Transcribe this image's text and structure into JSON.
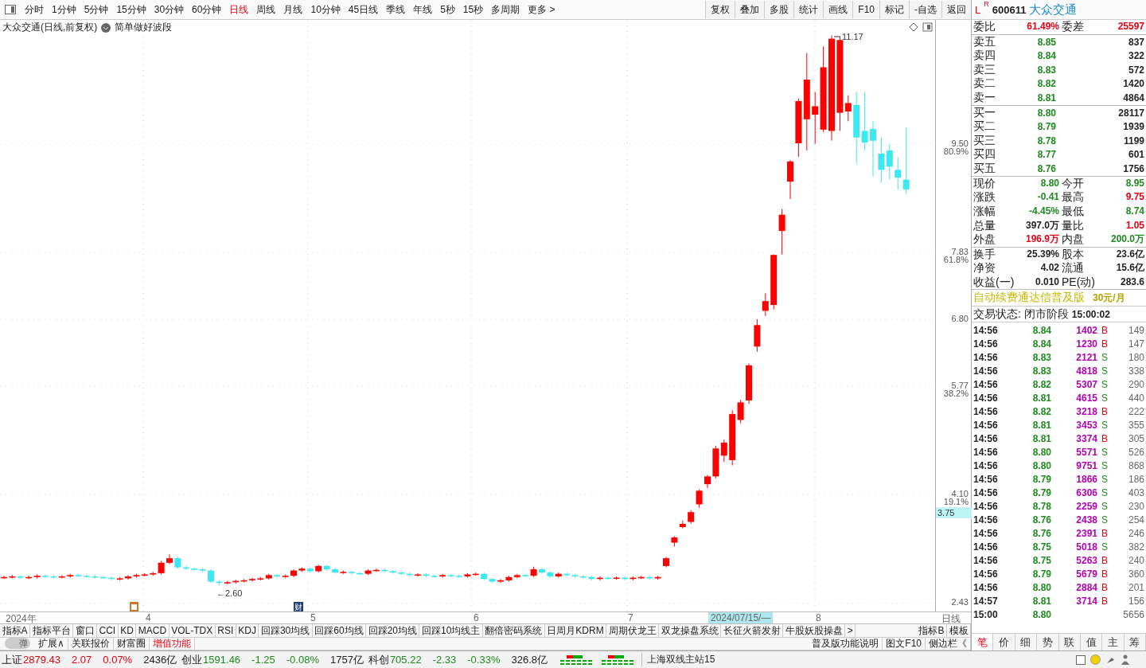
{
  "toolbar": {
    "periods": [
      {
        "label": "分时",
        "selected": false
      },
      {
        "label": "1分钟",
        "selected": false
      },
      {
        "label": "5分钟",
        "selected": false
      },
      {
        "label": "15分钟",
        "selected": false
      },
      {
        "label": "30分钟",
        "selected": false
      },
      {
        "label": "60分钟",
        "selected": false
      },
      {
        "label": "日线",
        "selected": true
      },
      {
        "label": "周线",
        "selected": false
      },
      {
        "label": "月线",
        "selected": false
      },
      {
        "label": "10分钟",
        "selected": false
      },
      {
        "label": "45日线",
        "selected": false
      },
      {
        "label": "季线",
        "selected": false
      },
      {
        "label": "年线",
        "selected": false
      },
      {
        "label": "5秒",
        "selected": false
      },
      {
        "label": "15秒",
        "selected": false
      },
      {
        "label": "多周期",
        "selected": false
      }
    ],
    "more": "更多 >",
    "actions": [
      "复权",
      "叠加",
      "多股",
      "统计",
      "画线",
      "F10",
      "标记",
      "-自选",
      "返回"
    ]
  },
  "chart": {
    "title": "大众交通(日线,前复权)",
    "indicator": "简单做好波段",
    "high_label": "11.17",
    "low_label": "←2.60",
    "marker": "财",
    "pct_labels": [
      "80.9%",
      "61.8%",
      "38.2%",
      "19.1%"
    ],
    "current_price": "3.75",
    "x_labels": [
      {
        "label": "2024年",
        "highlight": false
      },
      {
        "label": "4",
        "highlight": false
      },
      {
        "label": "5",
        "highlight": false
      },
      {
        "label": "6",
        "highlight": false
      },
      {
        "label": "7",
        "highlight": false
      },
      {
        "label": "2024/07/15/—",
        "highlight": true
      },
      {
        "label": "8",
        "highlight": false
      }
    ],
    "axis_title": "日线",
    "chart_data": {
      "type": "candlestick",
      "grid": true,
      "ylim": [
        2.3,
        11.41
      ],
      "yticks": [
        {
          "value": 9.5,
          "label": "9.50"
        },
        {
          "value": 7.83,
          "label": "7.83"
        },
        {
          "value": 6.8,
          "label": "6.80"
        },
        {
          "value": 5.77,
          "label": "5.77"
        },
        {
          "value": 4.1,
          "label": "4.10"
        },
        {
          "value": 2.43,
          "label": "2.43"
        }
      ],
      "ohlc": [
        [
          2.82,
          2.85,
          2.8,
          2.83
        ],
        [
          2.83,
          2.86,
          2.81,
          2.84
        ],
        [
          2.84,
          2.86,
          2.8,
          2.82
        ],
        [
          2.82,
          2.85,
          2.8,
          2.83
        ],
        [
          2.83,
          2.87,
          2.81,
          2.85
        ],
        [
          2.85,
          2.87,
          2.82,
          2.84
        ],
        [
          2.84,
          2.86,
          2.81,
          2.83
        ],
        [
          2.83,
          2.86,
          2.81,
          2.84
        ],
        [
          2.84,
          2.88,
          2.82,
          2.86
        ],
        [
          2.86,
          2.88,
          2.83,
          2.85
        ],
        [
          2.85,
          2.87,
          2.82,
          2.84
        ],
        [
          2.84,
          2.86,
          2.81,
          2.83
        ],
        [
          2.83,
          2.85,
          2.8,
          2.82
        ],
        [
          2.82,
          2.84,
          2.78,
          2.8
        ],
        [
          2.8,
          2.83,
          2.78,
          2.81
        ],
        [
          2.81,
          2.86,
          2.79,
          2.84
        ],
        [
          2.84,
          2.88,
          2.82,
          2.86
        ],
        [
          2.86,
          2.89,
          2.84,
          2.87
        ],
        [
          2.87,
          2.91,
          2.85,
          2.89
        ],
        [
          2.89,
          3.08,
          2.87,
          3.05
        ],
        [
          3.05,
          3.18,
          3.03,
          3.12
        ],
        [
          3.12,
          3.14,
          2.96,
          2.98
        ],
        [
          2.98,
          3.0,
          2.94,
          2.96
        ],
        [
          2.96,
          2.98,
          2.93,
          2.95
        ],
        [
          2.95,
          2.97,
          2.91,
          2.93
        ],
        [
          2.93,
          2.95,
          2.74,
          2.76
        ],
        [
          2.76,
          2.78,
          2.7,
          2.74
        ],
        [
          2.74,
          2.77,
          2.72,
          2.75
        ],
        [
          2.75,
          2.79,
          2.73,
          2.77
        ],
        [
          2.77,
          2.8,
          2.75,
          2.78
        ],
        [
          2.78,
          2.82,
          2.76,
          2.8
        ],
        [
          2.8,
          2.83,
          2.78,
          2.81
        ],
        [
          2.81,
          2.88,
          2.79,
          2.86
        ],
        [
          2.86,
          2.88,
          2.82,
          2.84
        ],
        [
          2.84,
          2.87,
          2.82,
          2.85
        ],
        [
          2.85,
          2.95,
          2.83,
          2.93
        ],
        [
          2.93,
          2.98,
          2.91,
          2.96
        ],
        [
          2.96,
          2.98,
          2.9,
          2.92
        ],
        [
          2.92,
          3.02,
          2.9,
          3.0
        ],
        [
          3.0,
          3.02,
          2.93,
          2.95
        ],
        [
          2.95,
          2.97,
          2.88,
          2.9
        ],
        [
          2.9,
          2.93,
          2.88,
          2.91
        ],
        [
          2.91,
          2.93,
          2.87,
          2.89
        ],
        [
          2.89,
          2.91,
          2.86,
          2.88
        ],
        [
          2.88,
          2.95,
          2.86,
          2.93
        ],
        [
          2.93,
          2.96,
          2.91,
          2.94
        ],
        [
          2.94,
          2.96,
          2.9,
          2.92
        ],
        [
          2.92,
          2.94,
          2.88,
          2.9
        ],
        [
          2.9,
          2.92,
          2.86,
          2.88
        ],
        [
          2.88,
          2.9,
          2.84,
          2.86
        ],
        [
          2.86,
          2.89,
          2.84,
          2.87
        ],
        [
          2.87,
          2.89,
          2.83,
          2.85
        ],
        [
          2.85,
          2.87,
          2.82,
          2.84
        ],
        [
          2.84,
          2.88,
          2.82,
          2.86
        ],
        [
          2.86,
          2.88,
          2.83,
          2.85
        ],
        [
          2.85,
          2.87,
          2.82,
          2.84
        ],
        [
          2.84,
          2.89,
          2.82,
          2.87
        ],
        [
          2.87,
          2.9,
          2.85,
          2.88
        ],
        [
          2.88,
          2.9,
          2.78,
          2.8
        ],
        [
          2.8,
          2.82,
          2.74,
          2.76
        ],
        [
          2.76,
          2.8,
          2.74,
          2.78
        ],
        [
          2.78,
          2.85,
          2.76,
          2.83
        ],
        [
          2.83,
          2.88,
          2.81,
          2.86
        ],
        [
          2.86,
          2.88,
          2.83,
          2.85
        ],
        [
          2.85,
          2.99,
          2.83,
          2.95
        ],
        [
          2.95,
          2.97,
          2.88,
          2.9
        ],
        [
          2.9,
          2.92,
          2.82,
          2.84
        ],
        [
          2.84,
          2.9,
          2.82,
          2.88
        ],
        [
          2.88,
          2.9,
          2.84,
          2.86
        ],
        [
          2.86,
          2.88,
          2.82,
          2.84
        ],
        [
          2.84,
          2.86,
          2.81,
          2.83
        ],
        [
          2.83,
          2.85,
          2.78,
          2.8
        ],
        [
          2.8,
          2.84,
          2.78,
          2.82
        ],
        [
          2.82,
          2.84,
          2.79,
          2.81
        ],
        [
          2.81,
          2.84,
          2.79,
          2.82
        ],
        [
          2.82,
          2.84,
          2.78,
          2.8
        ],
        [
          2.8,
          2.84,
          2.78,
          2.82
        ],
        [
          2.82,
          2.85,
          2.8,
          2.83
        ],
        [
          2.83,
          2.85,
          2.79,
          2.81
        ],
        [
          2.81,
          2.85,
          2.79,
          2.83
        ],
        [
          3.0,
          3.14,
          2.98,
          3.12
        ],
        [
          3.36,
          3.46,
          3.3,
          3.44
        ],
        [
          3.6,
          3.7,
          3.58,
          3.65
        ],
        [
          3.68,
          3.86,
          3.65,
          3.83
        ],
        [
          3.95,
          4.18,
          3.9,
          4.16
        ],
        [
          4.26,
          4.4,
          4.2,
          4.38
        ],
        [
          4.38,
          4.85,
          4.35,
          4.81
        ],
        [
          4.7,
          4.95,
          4.6,
          4.9
        ],
        [
          4.63,
          5.4,
          4.55,
          5.34
        ],
        [
          5.25,
          5.56,
          5.2,
          5.52
        ],
        [
          5.55,
          6.12,
          5.5,
          6.09
        ],
        [
          6.38,
          6.8,
          6.3,
          6.71
        ],
        [
          6.93,
          7.2,
          6.85,
          7.08
        ],
        [
          7.02,
          7.8,
          6.95,
          7.79
        ],
        [
          8.16,
          8.5,
          7.8,
          8.41
        ],
        [
          8.92,
          9.25,
          8.65,
          9.23
        ],
        [
          9.51,
          10.2,
          9.3,
          10.16
        ],
        [
          9.88,
          10.9,
          9.4,
          10.49
        ],
        [
          9.95,
          10.3,
          9.5,
          10.08
        ],
        [
          9.72,
          11.0,
          9.68,
          10.68
        ],
        [
          9.7,
          11.17,
          9.55,
          11.12
        ],
        [
          9.98,
          11.15,
          9.7,
          11.1
        ],
        [
          10.0,
          10.25,
          9.85,
          10.13
        ],
        [
          10.1,
          10.3,
          9.2,
          9.6
        ],
        [
          9.7,
          10.3,
          9.4,
          9.52
        ],
        [
          9.73,
          9.85,
          9.0,
          9.55
        ],
        [
          9.35,
          9.6,
          8.9,
          9.1
        ],
        [
          9.4,
          9.5,
          8.95,
          9.15
        ],
        [
          9.1,
          9.3,
          8.8,
          8.98
        ],
        [
          8.95,
          9.75,
          8.74,
          8.8
        ]
      ]
    }
  },
  "indicator_tabs": [
    "指标A",
    "指标平台",
    "窗口",
    "CCI",
    "KD",
    "MACD",
    "VOL-TDX",
    "RSI",
    "KDJ",
    "回踩30均线",
    "回踩60均线",
    "回踩20均线",
    "回踩10均线主",
    "翻倍密码系统",
    "日周月KDRM",
    "周期伏龙王",
    "双龙操盘系统",
    "长征火箭发射",
    "牛股妖股操盘",
    ">"
  ],
  "indicator_right": [
    "指标B",
    "模板"
  ],
  "function_bar": {
    "toggle": {
      "label": "弹",
      "on": false
    },
    "items": [
      {
        "label": "扩展∧",
        "kind": "plain"
      },
      {
        "label": "关联报价",
        "kind": "plain"
      },
      {
        "label": "财富圈",
        "kind": "plain"
      },
      {
        "label": "增值功能",
        "kind": "accent"
      }
    ],
    "right": [
      "普及版功能说明",
      "图文F10",
      "侧边栏《"
    ]
  },
  "quote": {
    "flags": [
      "L",
      "R"
    ],
    "code": "600611",
    "name": "大众交通",
    "ratio": {
      "label": "委比",
      "value": "61.49%",
      "label2": "委差",
      "value2": "25597"
    },
    "asks": [
      {
        "label": "卖五",
        "price": "8.85",
        "volume": "837"
      },
      {
        "label": "卖四",
        "price": "8.84",
        "volume": "322"
      },
      {
        "label": "卖三",
        "price": "8.83",
        "volume": "572"
      },
      {
        "label": "卖二",
        "price": "8.82",
        "volume": "1420"
      },
      {
        "label": "卖一",
        "price": "8.81",
        "volume": "4864"
      }
    ],
    "bids": [
      {
        "label": "买一",
        "price": "8.80",
        "volume": "28117"
      },
      {
        "label": "买二",
        "price": "8.79",
        "volume": "1939"
      },
      {
        "label": "买三",
        "price": "8.78",
        "volume": "1199"
      },
      {
        "label": "买四",
        "price": "8.77",
        "volume": "601"
      },
      {
        "label": "买五",
        "price": "8.76",
        "volume": "1756"
      }
    ],
    "stats": [
      {
        "left": {
          "label": "现价",
          "value": "8.80",
          "color": "#1f8a1f"
        },
        "right": {
          "label": "今开",
          "value": "8.95",
          "color": "#1f8a1f"
        }
      },
      {
        "left": {
          "label": "涨跌",
          "value": "-0.41",
          "color": "#1f8a1f"
        },
        "right": {
          "label": "最高",
          "value": "9.75",
          "color": "#e60012"
        }
      },
      {
        "left": {
          "label": "涨幅",
          "value": "-4.45%",
          "color": "#1f8a1f"
        },
        "right": {
          "label": "最低",
          "value": "8.74",
          "color": "#1f8a1f"
        }
      },
      {
        "left": {
          "label": "总量",
          "value": "397.0万",
          "color": "#222222"
        },
        "right": {
          "label": "量比",
          "value": "1.05",
          "color": "#e60012"
        }
      },
      {
        "left": {
          "label": "外盘",
          "value": "196.9万",
          "color": "#e60012"
        },
        "right": {
          "label": "内盘",
          "value": "200.0万",
          "color": "#1f8a1f"
        }
      }
    ],
    "fundamentals": [
      {
        "label": "换手",
        "value": "25.39%",
        "label2": "股本",
        "value2": "23.6亿"
      },
      {
        "label": "净资",
        "value": "4.02",
        "label2": "流通",
        "value2": "15.6亿"
      },
      {
        "label": "收益(一)",
        "value": "0.010",
        "label2": "PE(动)",
        "value2": "283.6"
      }
    ],
    "ad": {
      "text": "自动续费通达信普及版",
      "price": "30元/月"
    },
    "status": {
      "label": "交易状态: 闭市阶段",
      "time": "15:00:02"
    },
    "trades": [
      {
        "time": "14:56",
        "price": "8.84",
        "volume": "1402",
        "side": "B",
        "count": "149"
      },
      {
        "time": "14:56",
        "price": "8.84",
        "volume": "1230",
        "side": "B",
        "count": "147"
      },
      {
        "time": "14:56",
        "price": "8.83",
        "volume": "2121",
        "side": "S",
        "count": "180"
      },
      {
        "time": "14:56",
        "price": "8.83",
        "volume": "4818",
        "side": "S",
        "count": "338"
      },
      {
        "time": "14:56",
        "price": "8.82",
        "volume": "5307",
        "side": "S",
        "count": "290"
      },
      {
        "time": "14:56",
        "price": "8.81",
        "volume": "4615",
        "side": "S",
        "count": "440"
      },
      {
        "time": "14:56",
        "price": "8.82",
        "volume": "3218",
        "side": "B",
        "count": "222"
      },
      {
        "time": "14:56",
        "price": "8.81",
        "volume": "3453",
        "side": "S",
        "count": "355"
      },
      {
        "time": "14:56",
        "price": "8.81",
        "volume": "3374",
        "side": "B",
        "count": "305"
      },
      {
        "time": "14:56",
        "price": "8.80",
        "volume": "5571",
        "side": "S",
        "count": "526"
      },
      {
        "time": "14:56",
        "price": "8.80",
        "volume": "9751",
        "side": "S",
        "count": "868"
      },
      {
        "time": "14:56",
        "price": "8.79",
        "volume": "1866",
        "side": "S",
        "count": "186"
      },
      {
        "time": "14:56",
        "price": "8.79",
        "volume": "6306",
        "side": "S",
        "count": "403"
      },
      {
        "time": "14:56",
        "price": "8.78",
        "volume": "2259",
        "side": "S",
        "count": "230"
      },
      {
        "time": "14:56",
        "price": "8.76",
        "volume": "2438",
        "side": "S",
        "count": "254"
      },
      {
        "time": "14:56",
        "price": "8.76",
        "volume": "2391",
        "side": "B",
        "count": "246"
      },
      {
        "time": "14:56",
        "price": "8.75",
        "volume": "5018",
        "side": "S",
        "count": "382"
      },
      {
        "time": "14:56",
        "price": "8.75",
        "volume": "5263",
        "side": "B",
        "count": "240"
      },
      {
        "time": "14:56",
        "price": "8.79",
        "volume": "5679",
        "side": "B",
        "count": "360"
      },
      {
        "time": "14:56",
        "price": "8.80",
        "volume": "2884",
        "side": "B",
        "count": "201"
      },
      {
        "time": "14:57",
        "price": "8.81",
        "volume": "3714",
        "side": "B",
        "count": "156"
      },
      {
        "time": "15:00",
        "price": "8.80",
        "count": "5656"
      }
    ],
    "tabs": [
      {
        "label": "笔",
        "selected": true
      },
      {
        "label": "价",
        "selected": false
      },
      {
        "label": "细",
        "selected": false
      },
      {
        "label": "势",
        "selected": false
      },
      {
        "label": "联",
        "selected": false
      },
      {
        "label": "值",
        "selected": false
      },
      {
        "label": "主",
        "selected": false
      },
      {
        "label": "筹",
        "selected": false
      }
    ]
  },
  "status_bar": {
    "indices": [
      {
        "name": "上证",
        "value": "2879.43",
        "change": "2.07",
        "pct": "0.07%",
        "amount": "2436亿",
        "color": "#e60012"
      },
      {
        "name": "创业",
        "value": "1591.46",
        "change": "-1.25",
        "pct": "-0.08%",
        "amount": "1757亿",
        "color": "#1f8a1f"
      },
      {
        "name": "科创",
        "value": "705.22",
        "change": "-2.33",
        "pct": "-0.33%",
        "amount": "326.8亿",
        "color": "#1f8a1f"
      }
    ],
    "server": "上海双线主站15"
  }
}
